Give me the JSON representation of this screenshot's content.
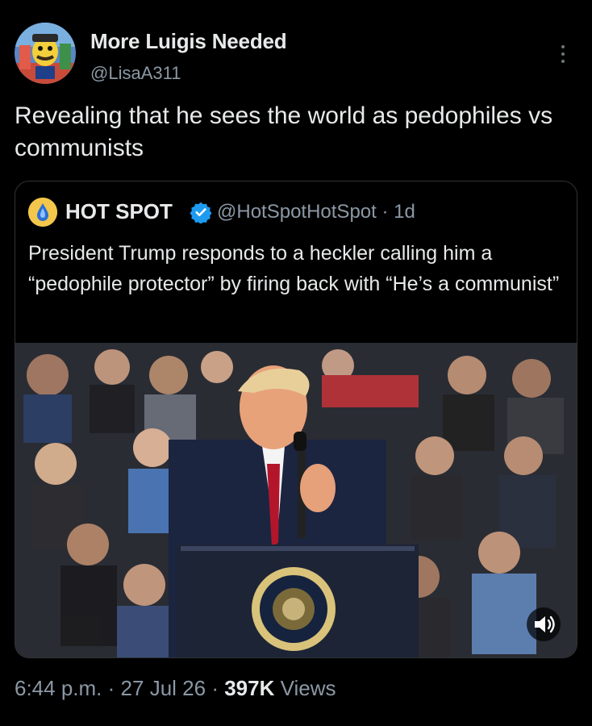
{
  "post": {
    "author_name": "More Luigis Needed",
    "author_handle": "@LisaA311",
    "text": "Revealing that he sees the world as pedophiles vs communists"
  },
  "quoted": {
    "author_name": "HOT SPOT",
    "author_handle": "@HotSpotHotSpot · 1d",
    "text": "President Trump responds to a heckler calling him a “pedophile protector” by firing back with “He’s a communist”"
  },
  "meta": {
    "time": "6:44 p.m.",
    "sep1": "·",
    "date": "27 Jul 26",
    "sep2": "·",
    "views_count": "397K",
    "views_label": "Views"
  },
  "icons": {
    "more": "more-vertical-icon",
    "verified": "verified-badge-icon",
    "sound": "speaker-volume-icon"
  },
  "colors": {
    "background": "#000000",
    "text": "#e7e9ea",
    "muted": "#8b98a5",
    "verified": "#1d9bf0"
  }
}
